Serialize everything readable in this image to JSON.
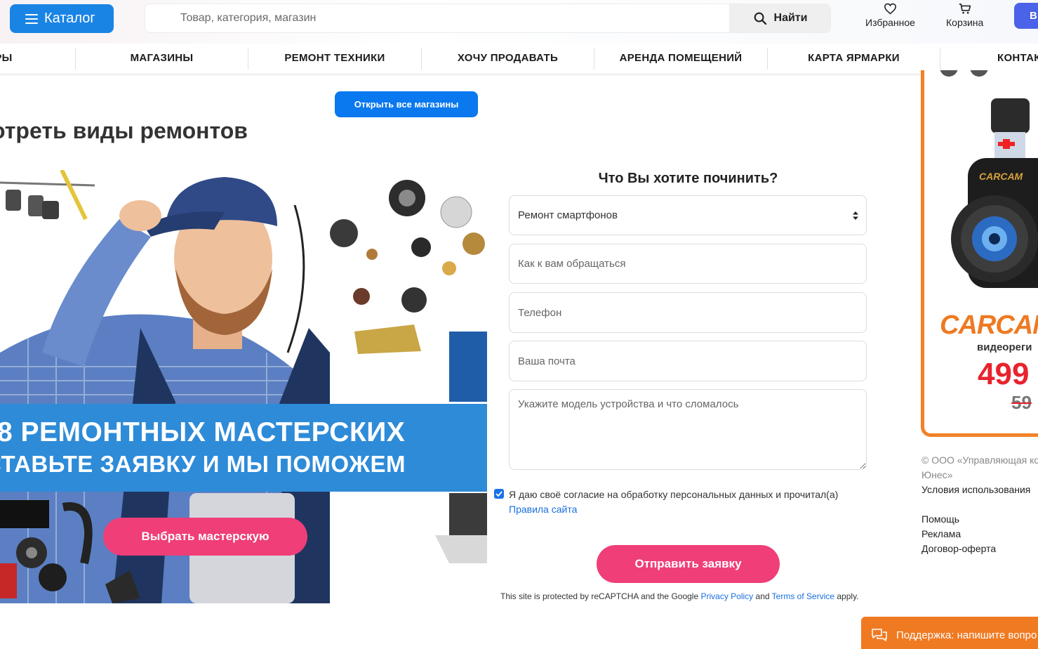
{
  "header": {
    "catalog_label": "Каталог",
    "search_placeholder": "Товар, категория, магазин",
    "search_button": "Найти",
    "favorites_label": "Избранное",
    "cart_label": "Корзина",
    "login_label": "В"
  },
  "nav": {
    "items": [
      "РЫ",
      "МАГАЗИНЫ",
      "РЕМОНТ ТЕХНИКИ",
      "ХОЧУ ПРОДАВАТЬ",
      "АРЕНДА ПОМЕЩЕНИЙ",
      "КАРТА ЯРМАРКИ",
      "КОНТАК"
    ]
  },
  "main": {
    "open_shops_button": "Открыть все магазины",
    "section_title": "отреть виды ремонтов",
    "hero": {
      "line1": "8 РЕМОНТНЫХ МАСТЕРСКИХ",
      "line2": "СТАВЬТЕ ЗАЯВКУ И МЫ ПОМОЖЕМ",
      "cta": "Выбрать мастерскую"
    },
    "form": {
      "title": "Что Вы хотите починить?",
      "select_value": "Ремонт смартфонов",
      "name_placeholder": "Как к вам обращаться",
      "phone_placeholder": "Телефон",
      "email_placeholder": "Ваша почта",
      "message_placeholder": "Укажите модель устройства и что сломалось",
      "consent_text": "Я даю своё согласие на обработку персональных данных и прочитал(а)",
      "consent_link": "Правила сайта",
      "consent_checked": true,
      "submit": "Отправить заявку",
      "recaptcha": {
        "prefix": "This site is protected by reCAPTCHA and the Google",
        "privacy": "Privacy Policy",
        "and": "and",
        "terms": "Terms of Service",
        "suffix": "apply."
      }
    }
  },
  "sidebar": {
    "ad": {
      "camera_label": "CARCAM",
      "brand": "CARCAM",
      "subtitle": "видеореги",
      "price": "499",
      "old_price": "59"
    },
    "footer": {
      "copyright_line1": "© ООО «Управляющая ко",
      "copyright_line2": "Юнес»",
      "terms": "Условия использования",
      "help": "Помощь",
      "ads": "Реклама",
      "offer": "Договор-оферта"
    }
  },
  "support": {
    "label": "Поддержка: напишите вопро"
  },
  "colors": {
    "brand_blue": "#1a84e5",
    "cta_pink": "#ef3e78",
    "ad_orange": "#f28127",
    "price_red": "#e8232e"
  }
}
